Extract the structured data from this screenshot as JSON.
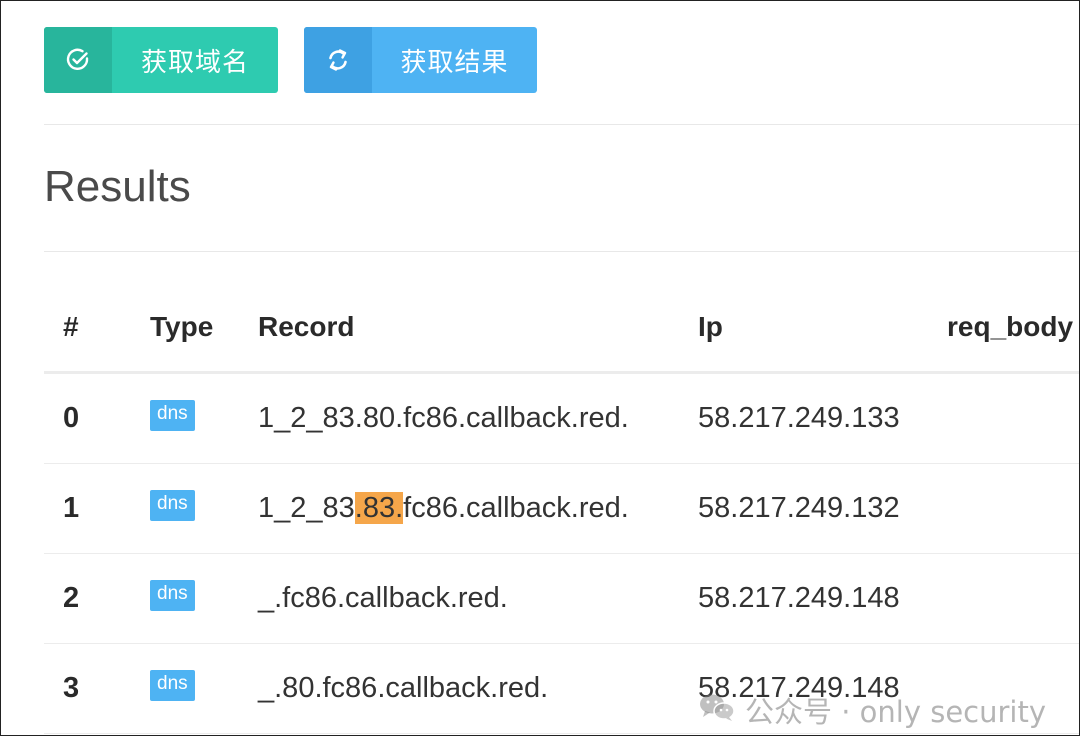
{
  "toolbar": {
    "get_domain_label": "获取域名",
    "get_result_label": "获取结果",
    "get_domain_icon": "check-circle-icon",
    "get_result_icon": "refresh-icon"
  },
  "results": {
    "title": "Results",
    "columns": {
      "num": "#",
      "type": "Type",
      "record": "Record",
      "ip": "Ip",
      "req_body": "req_body"
    },
    "rows": [
      {
        "num": "0",
        "type": "dns",
        "record": "1_2_83.80.fc86.callback.red.",
        "ip": "58.217.249.133"
      },
      {
        "num": "1",
        "type": "dns",
        "record_pre": "1_2_83",
        "record_hl": ".83.",
        "record_post": "fc86.callback.red.",
        "ip": "58.217.249.132"
      },
      {
        "num": "2",
        "type": "dns",
        "record": "_.fc86.callback.red.",
        "ip": "58.217.249.148"
      },
      {
        "num": "3",
        "type": "dns",
        "record": "_.80.fc86.callback.red.",
        "ip": "58.217.249.148"
      }
    ]
  },
  "watermark": {
    "text": "公众号 · only security",
    "icon": "wechat-icon"
  },
  "colors": {
    "teal": "#2ecbb0",
    "blue": "#4eb3f3",
    "highlight": "#f5a64a"
  }
}
